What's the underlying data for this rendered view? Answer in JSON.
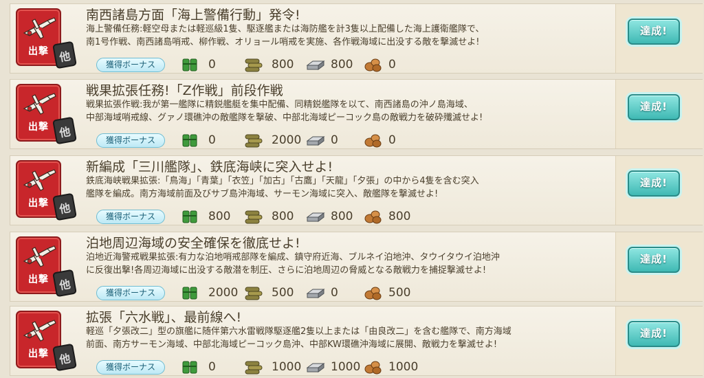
{
  "category_label": "出撃",
  "other_tag": "他",
  "bonus_label": "獲得ボーナス",
  "complete_label": "達成!",
  "colors": {
    "category_red": "#c8262b",
    "complete_teal": "#3fb9b4",
    "bonus_blue": "#bde9f5"
  },
  "resource_icons": [
    "fuel-icon",
    "ammo-icon",
    "steel-icon",
    "bauxite-icon"
  ],
  "quests": [
    {
      "title": "南西諸島方面「海上警備行動」発令!",
      "desc_1": "海上警備任務:軽空母または軽巡級1隻、駆逐艦または海防艦を計3隻以上配備した海上護衛艦隊で、",
      "desc_2": "南1号作戦、南西諸島哨戒、柳作戦、オリョール哨戒を実施、各作戦海域に出没する敵を撃滅せよ!",
      "fuel": "0",
      "ammo": "800",
      "steel": "800",
      "bauxite": "0"
    },
    {
      "title": "戦果拡張任務!「Z作戦」前段作戦",
      "desc_1": "戦果拡張作戦:我が第一艦隊に精鋭艦艇を集中配備、同精鋭艦隊を以て、南西諸島の沖ノ島海域、",
      "desc_2": "中部海域哨戒線、グァノ環礁沖の敵艦隊を撃破、中部北海域ピーコック島の敵戦力を破砕殲滅せよ!",
      "fuel": "0",
      "ammo": "2000",
      "steel": "0",
      "bauxite": "0"
    },
    {
      "title": "新編成「三川艦隊」、鉄底海峡に突入せよ!",
      "desc_1": "鉄底海峡戦果拡張:「鳥海」「青葉」「衣笠」「加古」「古鷹」「天龍」「夕張」の中から4隻を含む突入",
      "desc_2": "艦隊を編成。南方海域前面及びサブ島沖海域、サーモン海域に突入、敵艦隊を撃滅せよ!",
      "fuel": "800",
      "ammo": "800",
      "steel": "800",
      "bauxite": "800"
    },
    {
      "title": "泊地周辺海域の安全確保を徹底せよ!",
      "desc_1": "泊地近海警戒戦果拡張:有力な泊地哨戒部隊を編成、鎮守府近海、ブルネイ泊地沖、タウイタウイ泊地沖",
      "desc_2": "に反復出撃!各周辺海域に出没する敵潜を制圧、さらに泊地周辺の脅威となる敵戦力を捕捉撃滅せよ!",
      "fuel": "2000",
      "ammo": "500",
      "steel": "0",
      "bauxite": "500"
    },
    {
      "title": "拡張「六水戦」、最前線へ!",
      "desc_1": "軽巡「夕張改二」型の旗艦に随伴第六水雷戦隊駆逐艦2隻以上または「由良改二」を含む艦隊で、南方海域",
      "desc_2": "前面、南方サーモン海域、中部北海域ピーコック島沖、中部KW環礁沖海域に展開、敵戦力を撃滅せよ!",
      "fuel": "0",
      "ammo": "1000",
      "steel": "1000",
      "bauxite": "1000"
    }
  ]
}
